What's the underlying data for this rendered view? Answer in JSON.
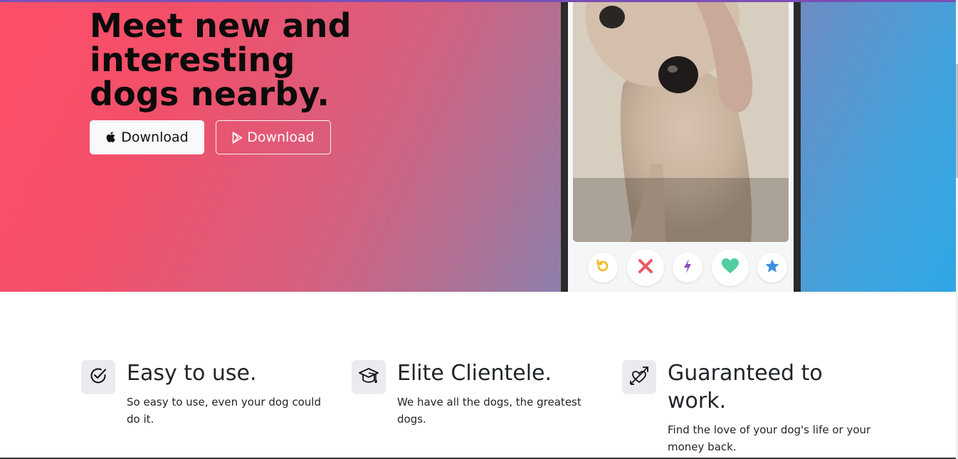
{
  "hero": {
    "headline": "Meet new and interesting dogs nearby.",
    "apple_button_label": "Download",
    "play_button_label": "Download",
    "colors": {
      "gradient_start": "#ff4f6a",
      "gradient_end": "#2fa7e6"
    }
  },
  "phone": {
    "actions": [
      {
        "icon": "rewind-icon",
        "color": "#f5b81c"
      },
      {
        "icon": "nope-x-icon",
        "color": "#ec5766"
      },
      {
        "icon": "boost-bolt-icon",
        "color": "#8a4fc4"
      },
      {
        "icon": "like-heart-icon",
        "color": "#4fcf9f"
      },
      {
        "icon": "super-like-star-icon",
        "color": "#3d8fe0"
      }
    ]
  },
  "features": [
    {
      "icon": "check-circle-icon",
      "title": "Easy to use.",
      "text": "So easy to use, even your dog could do it."
    },
    {
      "icon": "graduation-cap-icon",
      "title": "Elite Clientele.",
      "text": "We have all the dogs, the greatest dogs."
    },
    {
      "icon": "heart-arrow-icon",
      "title": "Guaranteed to work.",
      "text": "Find the love of your dog's life or your money back."
    }
  ]
}
